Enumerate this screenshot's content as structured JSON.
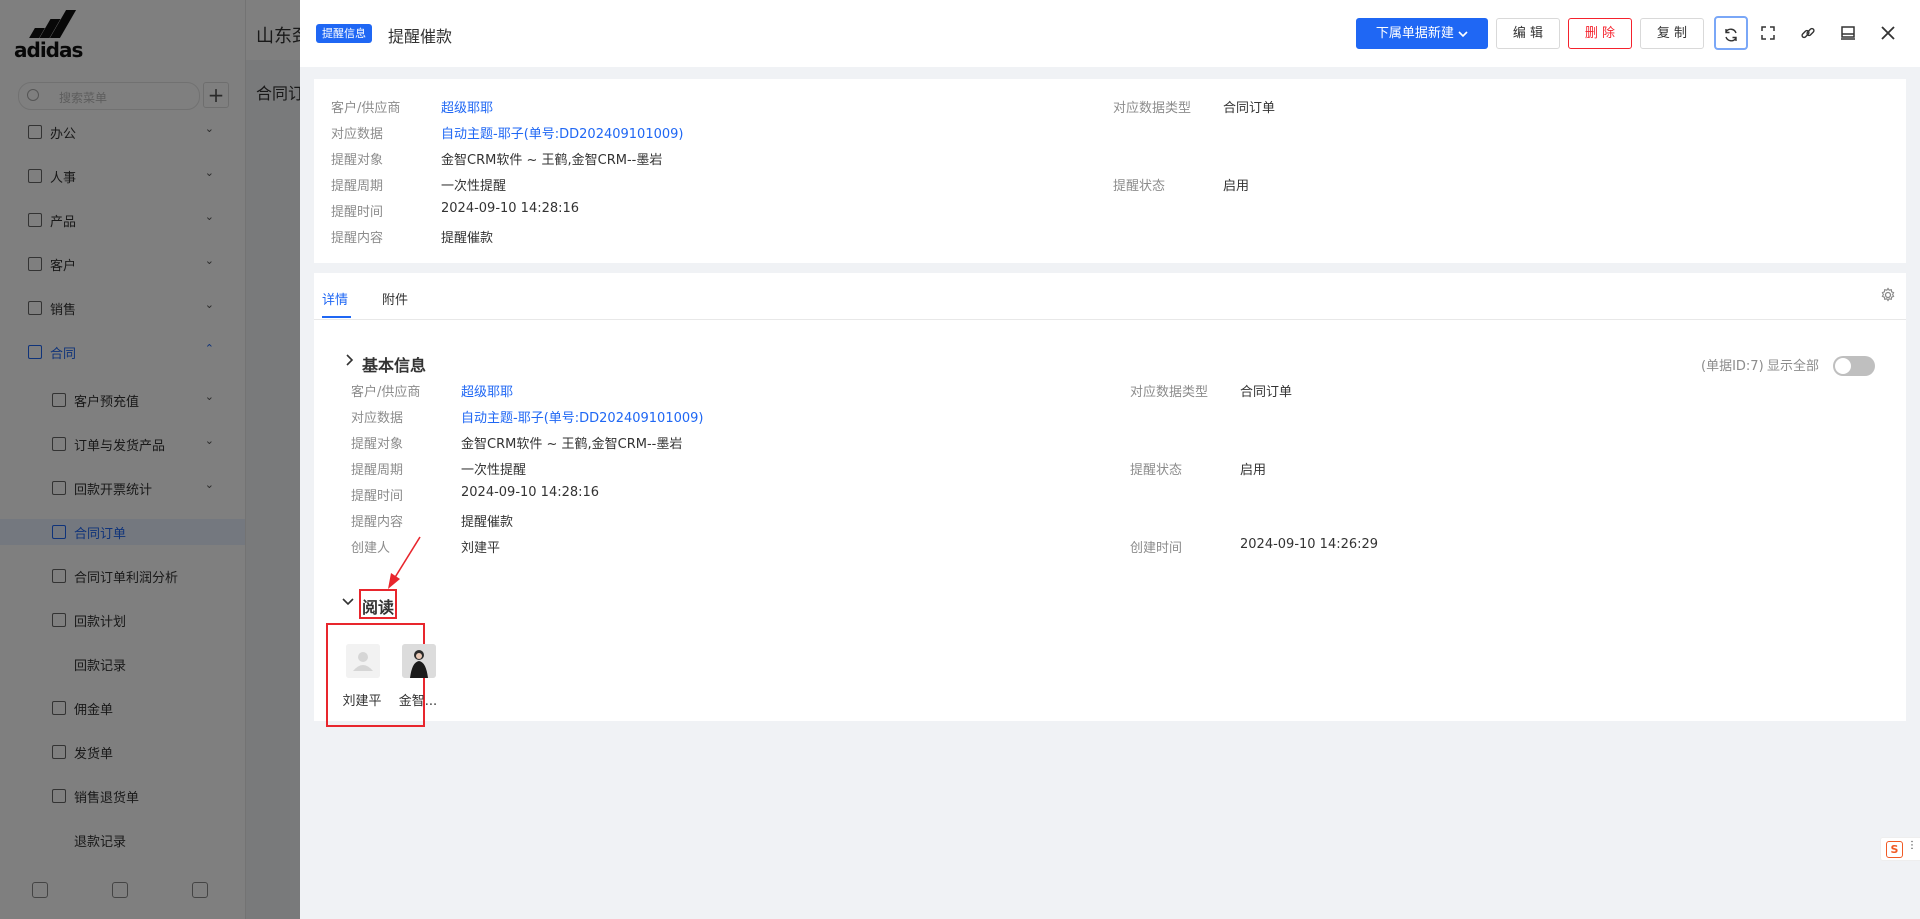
{
  "background": {
    "header_title": "山东劲",
    "subtitle": "合同订",
    "search_placeholder": "搜索菜单",
    "nav": [
      {
        "label": "办公"
      },
      {
        "label": "人事"
      },
      {
        "label": "产品"
      },
      {
        "label": "客户"
      },
      {
        "label": "销售"
      },
      {
        "label": "合同"
      },
      {
        "label": "客户预充值"
      },
      {
        "label": "订单与发货产品"
      },
      {
        "label": "回款开票统计"
      },
      {
        "label": "合同订单"
      },
      {
        "label": "合同订单利润分析"
      },
      {
        "label": "回款计划"
      },
      {
        "label": "回款记录"
      },
      {
        "label": "佣金单"
      },
      {
        "label": "发货单"
      },
      {
        "label": "销售退货单"
      },
      {
        "label": "退款记录"
      }
    ]
  },
  "drawer": {
    "badge": "提醒信息",
    "title": "提醒催款",
    "buttons": {
      "new_sub": "下属单据新建",
      "edit": "编 辑",
      "delete": "删 除",
      "copy": "复 制"
    },
    "summary": {
      "rows": [
        {
          "label": "客户/供应商",
          "value": "超级耶耶",
          "link": true
        },
        {
          "label": "对应数据",
          "value": "自动主题-耶子(单号:DD202409101009)",
          "link": true
        },
        {
          "label": "提醒对象",
          "value": "金智CRM软件 ~ 王鹤,金智CRM--墨岩"
        },
        {
          "label": "提醒周期",
          "value": "一次性提醒"
        },
        {
          "label": "提醒时间",
          "value": "2024-09-10 14:28:16"
        },
        {
          "label": "提醒内容",
          "value": "提醒催款"
        }
      ],
      "right": [
        {
          "label": "对应数据类型",
          "value": "合同订单"
        },
        {
          "label": "提醒状态",
          "value": "启用"
        }
      ]
    },
    "tabs": [
      "详情",
      "附件"
    ],
    "basic": {
      "title": "基本信息",
      "doc_id": "(单据ID:7)",
      "show_all": "显示全部",
      "rows": [
        {
          "label": "客户/供应商",
          "value": "超级耶耶",
          "link": true
        },
        {
          "label": "对应数据",
          "value": "自动主题-耶子(单号:DD202409101009)",
          "link": true
        },
        {
          "label": "提醒对象",
          "value": "金智CRM软件 ~ 王鹤,金智CRM--墨岩"
        },
        {
          "label": "提醒周期",
          "value": "一次性提醒"
        },
        {
          "label": "提醒时间",
          "value": "2024-09-10 14:28:16"
        },
        {
          "label": "提醒内容",
          "value": "提醒催款"
        },
        {
          "label": "创建人",
          "value": "刘建平"
        }
      ],
      "right": [
        {
          "label": "对应数据类型",
          "value": "合同订单"
        },
        {
          "label": "提醒状态",
          "value": "启用"
        },
        {
          "label": "创建时间",
          "value": "2024-09-10 14:26:29"
        }
      ]
    },
    "reading": {
      "title": "阅读",
      "readers": [
        {
          "name": "刘建平",
          "avatar": "default-user-avatar"
        },
        {
          "name": "金智...",
          "avatar": "photo-avatar"
        }
      ]
    },
    "colors": {
      "primary": "#1f67f4",
      "danger": "#f5222d",
      "annotation": "#e8262d"
    }
  }
}
